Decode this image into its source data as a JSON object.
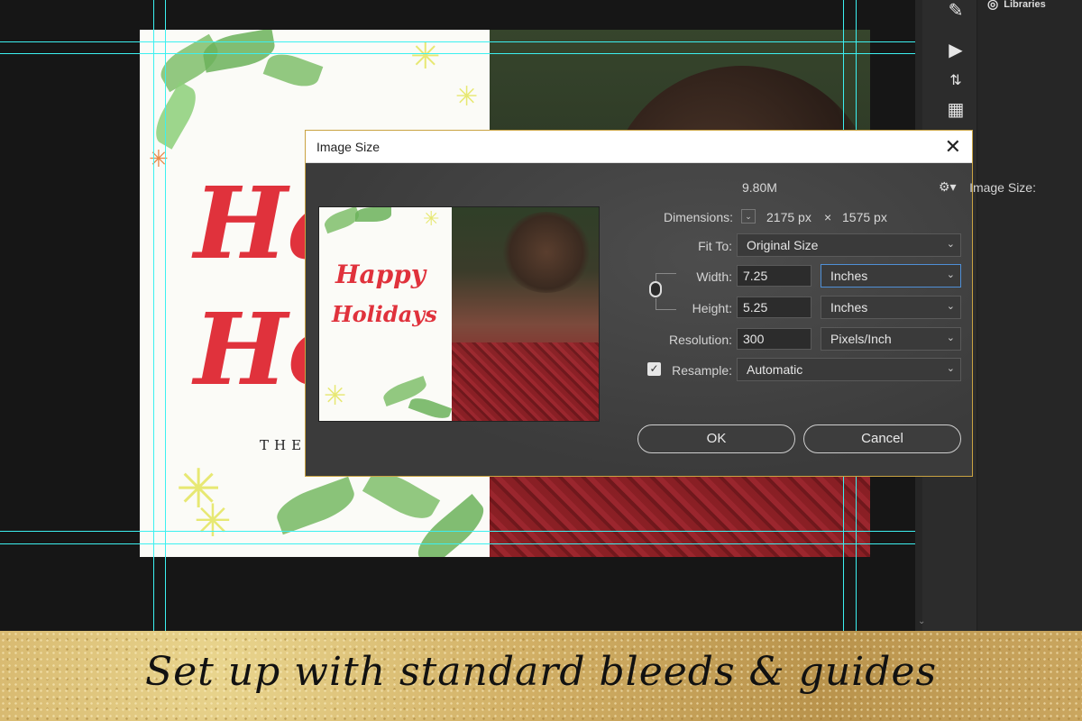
{
  "side_panel": {
    "libraries_label": "Libraries"
  },
  "card_preview": {
    "script_line1": "Hap",
    "script_line2": "Hol",
    "signoff": "THE"
  },
  "dialog": {
    "title": "Image Size",
    "image_size_label": "Image Size:",
    "image_size_value": "9.80M",
    "dimensions_label": "Dimensions:",
    "dim_width": "2175 px",
    "dim_times": "×",
    "dim_height": "1575 px",
    "fit_to_label": "Fit To:",
    "fit_to_value": "Original Size",
    "width_label": "Width:",
    "width_value": "7.25",
    "width_unit": "Inches",
    "height_label": "Height:",
    "height_value": "5.25",
    "height_unit": "Inches",
    "resolution_label": "Resolution:",
    "resolution_value": "300",
    "resolution_unit": "Pixels/Inch",
    "resample_label": "Resample:",
    "resample_checked": true,
    "resample_value": "Automatic",
    "ok_label": "OK",
    "cancel_label": "Cancel",
    "preview": {
      "script_line1": "Happy",
      "script_line2": "Holidays"
    }
  },
  "banner": {
    "text": "Set up with standard bleeds & guides"
  },
  "colors": {
    "guide": "#3cf0f0",
    "dialog_border": "#c9a342",
    "script_red": "#e0323c"
  }
}
